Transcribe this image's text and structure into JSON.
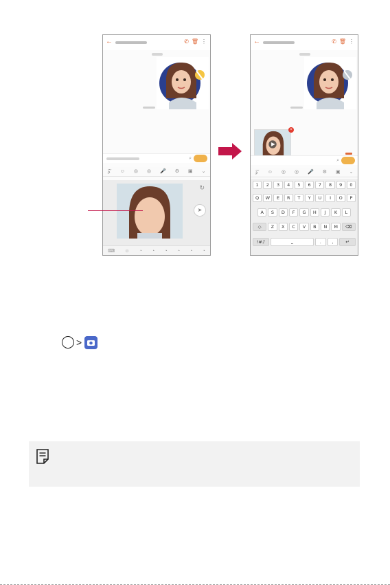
{
  "figure": {
    "left_phone": {
      "label": "Phone screen with AR sticker preview",
      "icons": {
        "back": "arrow-left-icon",
        "call": "phone-icon",
        "delete": "trash-icon",
        "more": "more-vert-icon",
        "clip": "paperclip-icon",
        "refresh": "refresh-icon",
        "send": "send-icon",
        "play": "play-icon"
      },
      "toolbar_icons": [
        "𝒵",
        "☺",
        "◎",
        "◎",
        "🎤",
        "⚙",
        "▣",
        "⌄"
      ],
      "sticker_bar_icons": [
        "⌨",
        "☺",
        "◔",
        "◔",
        "◔",
        "◔",
        "◔",
        "◔"
      ]
    },
    "right_phone": {
      "label": "Phone screen after sticker attached",
      "keyboard": {
        "row1": [
          "1",
          "2",
          "3",
          "4",
          "5",
          "6",
          "7",
          "8",
          "9",
          "0"
        ],
        "row2": [
          "Q",
          "W",
          "E",
          "R",
          "T",
          "Y",
          "U",
          "I",
          "O",
          "P"
        ],
        "row3": [
          "A",
          "S",
          "D",
          "F",
          "G",
          "H",
          "J",
          "K",
          "L"
        ],
        "row4": [
          "◇",
          "Z",
          "X",
          "C",
          "V",
          "B",
          "N",
          "M",
          "⌫"
        ],
        "row5": [
          "!#♪",
          "⎵",
          ".",
          ",",
          "↵"
        ]
      },
      "toolbar_icons": [
        "𝒵",
        "☺",
        "◎",
        "◎",
        "🎤",
        "⚙",
        "▣",
        "⌄"
      ]
    },
    "transition_arrow": {
      "color": "#c3164a"
    },
    "accent_color": "#c3164a"
  },
  "step": {
    "icons": [
      "home-circle-icon",
      "chevron-right-icon",
      "camera-app-icon"
    ],
    "chevron": ">"
  },
  "note_box": {
    "icon": "note-icon",
    "background": "#f2f2f2"
  }
}
